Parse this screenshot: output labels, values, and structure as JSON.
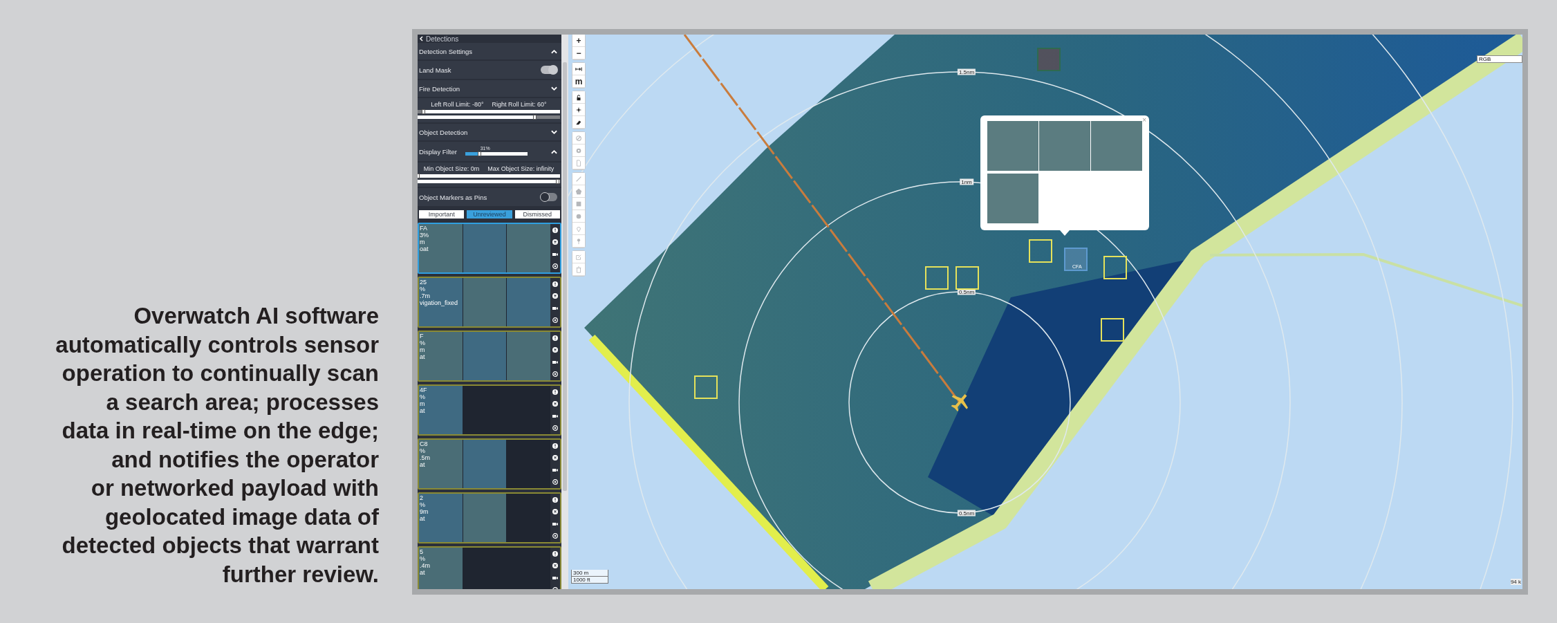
{
  "text_panel": {
    "paragraph": "Overwatch AI software\nautomatically controls sensor\noperation to continually scan\na search area; processes\ndata in real-time on the edge;\nand notifies the operator\nor networked payload with\ngeolocated image data of\ndetected objects that warrant\nfurther review."
  },
  "sidebar": {
    "title": "Detections",
    "rows": [
      {
        "kind": "section",
        "label": "Detection Settings",
        "expanded": true
      },
      {
        "kind": "toggle",
        "label": "Land Mask",
        "on": true
      },
      {
        "kind": "section",
        "label": "Fire Detection",
        "expanded": false
      },
      {
        "kind": "range",
        "captions": [
          "Left Roll Limit: -80°",
          "Right Roll Limit: 60°"
        ],
        "sliders": [
          {
            "kind": "lower",
            "level": 0.04
          },
          {
            "kind": "upper",
            "level": 0.82
          }
        ]
      },
      {
        "kind": "section",
        "label": "Object Detection",
        "expanded": false
      },
      {
        "kind": "filter",
        "label": "Display Filter",
        "reading": "31%",
        "level": 0.22,
        "expanded": true
      },
      {
        "kind": "range",
        "captions": [
          "Min Object Size: 0m",
          "Max Object Size: infinity"
        ],
        "sliders": [
          {
            "kind": "lower",
            "level": 0
          },
          {
            "kind": "upper",
            "level": 1
          }
        ]
      },
      {
        "kind": "toggle",
        "label": "Object Markers as Pins",
        "on": false
      }
    ],
    "tabs": [
      {
        "label": "Important",
        "selected": false
      },
      {
        "label": "Unreviewed",
        "selected": true
      },
      {
        "label": "Dismissed",
        "selected": false
      }
    ],
    "cards": [
      {
        "selected": true,
        "lines": [
          "FA",
          "3%",
          "m",
          "oat"
        ],
        "thumbnails": [
          {
            "kind": "photo"
          },
          {
            "kind": "photo"
          },
          {
            "kind": "photo"
          }
        ]
      },
      {
        "selected": false,
        "lines": [
          "25",
          "%",
          ".7m",
          "vigation_fixed"
        ],
        "thumbnails": [
          {
            "kind": "photo"
          },
          {
            "kind": "photo"
          },
          {
            "kind": "photo"
          }
        ]
      },
      {
        "selected": false,
        "lines": [
          "F",
          "%",
          "m",
          "at"
        ],
        "thumbnails": [
          {
            "kind": "photo"
          },
          {
            "kind": "photo"
          },
          {
            "kind": "photo"
          }
        ]
      },
      {
        "selected": false,
        "lines": [
          "4F",
          "%",
          "m",
          "at"
        ],
        "thumbnails": [
          {
            "kind": "photo"
          }
        ]
      },
      {
        "selected": false,
        "lines": [
          "C8",
          "%",
          ".5m",
          "at"
        ],
        "thumbnails": [
          {
            "kind": "photo"
          },
          {
            "kind": "photo"
          }
        ]
      },
      {
        "selected": false,
        "lines": [
          "2",
          "%",
          "9m",
          "at"
        ],
        "thumbnails": [
          {
            "kind": "photo"
          },
          {
            "kind": "photo"
          }
        ]
      },
      {
        "selected": false,
        "lines": [
          "5",
          "%",
          ".4m",
          "at"
        ],
        "thumbnails": [
          {
            "kind": "photo"
          }
        ]
      }
    ]
  },
  "map": {
    "toolbar": [
      [
        {
          "kind": "text",
          "label": "+",
          "disabled": false
        },
        {
          "kind": "text",
          "label": "−",
          "disabled": false
        }
      ],
      [
        {
          "kind": "measure",
          "disabled": false
        },
        {
          "kind": "text",
          "label": "m",
          "disabled": false
        }
      ],
      [
        {
          "kind": "lock",
          "disabled": false
        },
        {
          "kind": "plane",
          "disabled": false
        },
        {
          "kind": "eraser",
          "disabled": false
        }
      ],
      [
        {
          "kind": "ban",
          "disabled": true
        },
        {
          "kind": "gear",
          "disabled": true
        },
        {
          "kind": "document",
          "disabled": true
        }
      ],
      [
        {
          "kind": "line",
          "disabled": true
        },
        {
          "kind": "pentagon",
          "disabled": true
        },
        {
          "kind": "square",
          "disabled": true
        },
        {
          "kind": "circle",
          "disabled": true
        },
        {
          "kind": "marker",
          "disabled": true
        },
        {
          "kind": "pin",
          "disabled": true
        }
      ],
      [
        {
          "kind": "edit",
          "disabled": true
        },
        {
          "kind": "trash",
          "disabled": true
        }
      ]
    ],
    "ring_labels": [
      "1.5nm",
      "1nm",
      "0.5nm",
      "0.5nm"
    ],
    "detections": [
      {
        "kind": "box",
        "selected": false
      },
      {
        "kind": "box",
        "selected": false
      },
      {
        "kind": "box",
        "selected": false
      },
      {
        "kind": "box",
        "selected": false
      },
      {
        "kind": "box",
        "selected": true,
        "label": "CFA"
      },
      {
        "kind": "box",
        "selected": false
      },
      {
        "kind": "box",
        "selected": false
      },
      {
        "kind": "faded",
        "selected": false
      }
    ],
    "popup": {
      "close": "×",
      "thumbnails": [
        {
          "kind": "photo"
        },
        {
          "kind": "photo"
        },
        {
          "kind": "photo"
        },
        {
          "kind": "photo"
        }
      ]
    },
    "layer_field": {
      "value": "RGB"
    },
    "scale": [
      "300 m",
      "1000 ft"
    ],
    "corner_text": "94 k"
  }
}
